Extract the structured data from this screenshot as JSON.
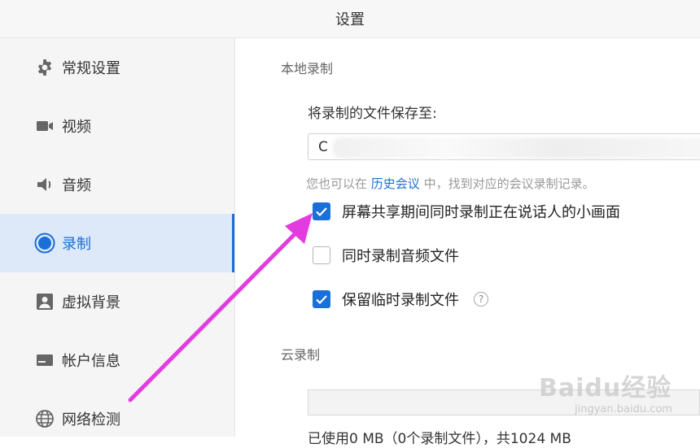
{
  "window": {
    "title": "设置"
  },
  "sidebar": {
    "items": [
      {
        "label": "常规设置",
        "icon": "gear-icon"
      },
      {
        "label": "视频",
        "icon": "video-camera-icon"
      },
      {
        "label": "音频",
        "icon": "speaker-icon"
      },
      {
        "label": "录制",
        "icon": "record-icon",
        "active": true
      },
      {
        "label": "虚拟背景",
        "icon": "portrait-icon"
      },
      {
        "label": "帐户信息",
        "icon": "id-card-icon"
      },
      {
        "label": "网络检测",
        "icon": "globe-icon"
      }
    ]
  },
  "local": {
    "section_title": "本地录制",
    "save_label": "将录制的文件保存至:",
    "path_value": "C",
    "hint_prefix": "您也可以在",
    "hint_link": "历史会议",
    "hint_suffix": "中，找到对应的会议录制记录。",
    "options": [
      {
        "label": "屏幕共享期间同时录制正在说话人的小画面",
        "checked": true
      },
      {
        "label": "同时录制音频文件",
        "checked": false
      },
      {
        "label": "保留临时录制文件",
        "checked": true
      }
    ]
  },
  "cloud": {
    "section_title": "云录制",
    "usage": "已使用0 MB（0个录制文件），共1024 MB"
  },
  "watermark": {
    "brand": "Baidu经验",
    "url": "jingyan.baidu.com"
  },
  "colors": {
    "accent": "#1b6fd8",
    "annotation_arrow": "#e43be0"
  }
}
